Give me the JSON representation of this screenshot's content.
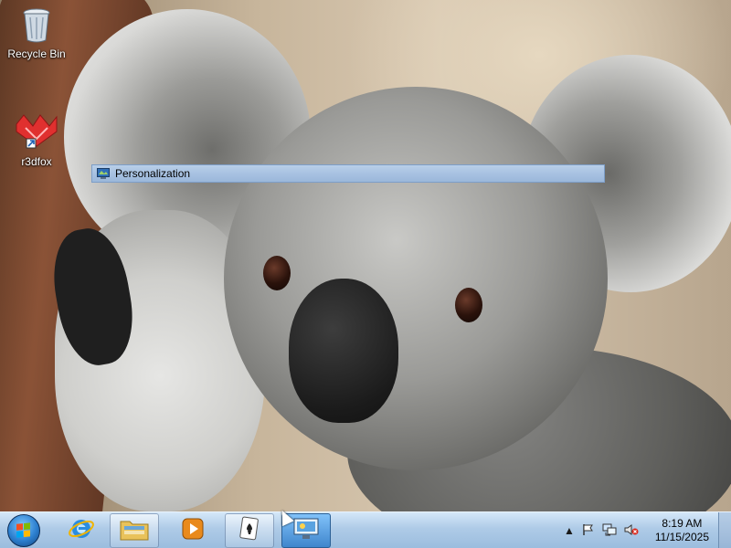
{
  "desktop": {
    "icons": [
      {
        "label": "Recycle Bin",
        "icon": "recycle-bin-icon"
      },
      {
        "label": "r3dfox",
        "icon": "r3dfox-icon"
      }
    ]
  },
  "window": {
    "title": "Personalization",
    "icon": "personalization-icon"
  },
  "taskbar": {
    "start_icon": "windows-start-icon",
    "pinned": [
      {
        "name": "internet-explorer",
        "icon": "internet-explorer-icon"
      },
      {
        "name": "file-explorer",
        "icon": "folder-icon"
      },
      {
        "name": "media-player",
        "icon": "media-player-icon"
      },
      {
        "name": "solitaire",
        "icon": "solitaire-icon"
      },
      {
        "name": "personalization",
        "icon": "personalization-icon"
      }
    ],
    "tray": {
      "show_hidden_icon": "▲",
      "flag_icon": "action-center-flag-icon",
      "network_icon": "network-icon",
      "volume_icon": "volume-muted-icon"
    },
    "clock": {
      "time": "8:19 AM",
      "date": "11/15/2025"
    }
  },
  "colors": {
    "taskbar": "#aac8e6",
    "title_bar": "#a8c2e2",
    "start_orb": "#2c7fcf"
  }
}
